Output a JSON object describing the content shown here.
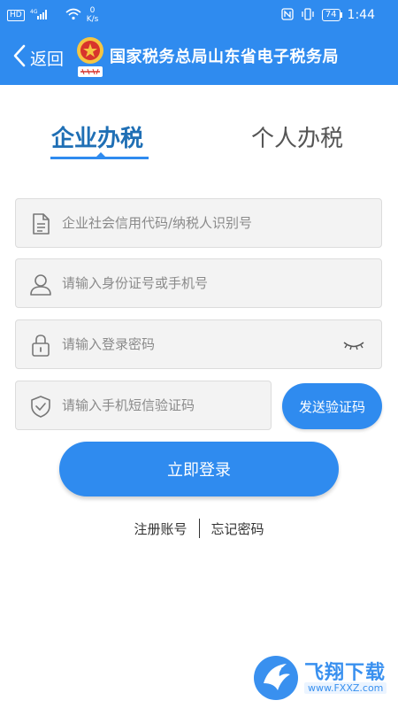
{
  "status_bar": {
    "hd": "HD",
    "net": "4G",
    "speed_value": "0",
    "speed_unit": "K/s",
    "battery": "74",
    "time": "1:44"
  },
  "header": {
    "back_label": "返回",
    "title": "国家税务总局山东省电子税务局"
  },
  "tabs": [
    {
      "label": "企业办税",
      "active": true
    },
    {
      "label": "个人办税",
      "active": false
    }
  ],
  "form": {
    "credit_code_placeholder": "企业社会信用代码/纳税人识别号",
    "id_placeholder": "请输入身份证号或手机号",
    "password_placeholder": "请输入登录密码",
    "sms_placeholder": "请输入手机短信验证码",
    "send_code_label": "发送验证码",
    "login_label": "立即登录"
  },
  "links": {
    "register": "注册账号",
    "forgot": "忘记密码"
  },
  "watermark": {
    "brand": "飞翔下载",
    "url": "www.FXXZ.com"
  },
  "colors": {
    "primary": "#2f8bef",
    "tab_active": "#1f6fb5",
    "field_bg": "#f3f3f3"
  }
}
